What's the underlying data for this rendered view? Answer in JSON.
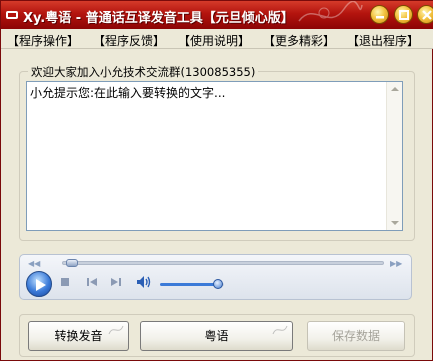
{
  "window": {
    "title": "Xy.粤语 - 普通话互译发音工具【元旦倾心版】"
  },
  "menu": [
    {
      "label": "【程序操作】"
    },
    {
      "label": "【程序反馈】"
    },
    {
      "label": "【使用说明】"
    },
    {
      "label": "【更多精彩】"
    },
    {
      "label": "【退出程序】"
    }
  ],
  "input_group": {
    "label": "欢迎大家加入小允技术交流群(130085355)",
    "text": "小允提示您:在此输入要转换的文字..."
  },
  "player": {
    "seek_progress": 0.03,
    "volume_level": 0.9,
    "icons": [
      "play-icon",
      "stop-icon",
      "previous-icon",
      "next-icon",
      "speaker-icon"
    ]
  },
  "buttons": {
    "convert_label": "转换发音",
    "cantonese_label": "粤语",
    "save_label": "保存数据"
  },
  "colors": {
    "titlebar": "#b3140e",
    "accent": "#3b7ad8"
  }
}
